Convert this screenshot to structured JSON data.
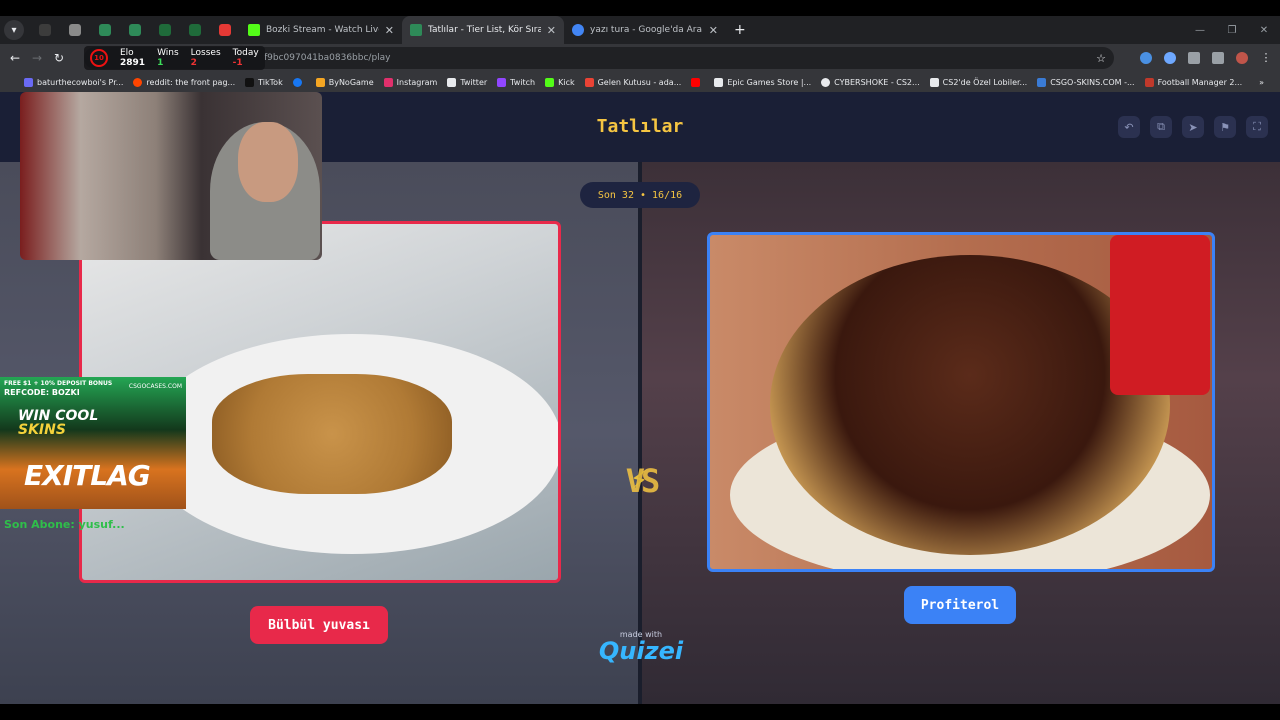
{
  "browser": {
    "tabs": [
      {
        "label": "Bozki Stream - Watch Live on K",
        "color": "#53fc18",
        "active": false
      },
      {
        "label": "Tatlılar - Tier List, Kör Sıralama,",
        "color": "#2e8a58",
        "active": true
      },
      {
        "label": "yazı tura - Google'da Ara",
        "color": "#4285f4",
        "active": false
      }
    ],
    "url": "f9bc097041ba0836bbc/play",
    "bookmarks": [
      {
        "label": "baturthecowboi's Pr...",
        "color": "#6a6af4"
      },
      {
        "label": "reddit: the front pag...",
        "color": "#ff4500"
      },
      {
        "label": "TikTok",
        "color": "#111111"
      },
      {
        "label": "",
        "color": "#1877f2"
      },
      {
        "label": "ByNoGame",
        "color": "#f5a623"
      },
      {
        "label": "Instagram",
        "color": "#e1306c"
      },
      {
        "label": "Twitter",
        "color": "#e8eaed"
      },
      {
        "label": "Twitch",
        "color": "#9146ff"
      },
      {
        "label": "Kick",
        "color": "#53fc18"
      },
      {
        "label": "Gelen Kutusu - ada...",
        "color": "#ea4335"
      },
      {
        "label": "",
        "color": "#ff0000"
      },
      {
        "label": "Epic Games Store |...",
        "color": "#e8eaed"
      },
      {
        "label": "CYBERSHOKE - CS2...",
        "color": "#e8eaed"
      },
      {
        "label": "CS2'de Özel Lobiler...",
        "color": "#e8eaed"
      },
      {
        "label": "CSGO-SKINS.COM -...",
        "color": "#3a7bd5"
      },
      {
        "label": "Football Manager 2...",
        "color": "#c0392b"
      }
    ],
    "elo": {
      "level": "10",
      "elo_label": "Elo",
      "elo_value": "2891",
      "wins_label": "Wins",
      "wins_value": "1",
      "losses_label": "Losses",
      "losses_value": "2",
      "today_label": "Today",
      "today_value": "-1"
    }
  },
  "page": {
    "title": "Tatlılar",
    "round": "Son 32 • 16/16",
    "left_option": "Bülbül yuvası",
    "right_option": "Profiterol",
    "vs": "VS",
    "made_with": "made with",
    "brand": "Quizei"
  },
  "overlays": {
    "ad_line1": "FREE $1 + 10% DEPOSIT BONUS",
    "ad_code": "REFCODE: BOZKI",
    "ad_site": "CSGOCASES.COM",
    "ad_headline_1": "WIN COOL",
    "ad_headline_2": "SKINS",
    "ad_brand": "EXITLAG",
    "subscriber": "Son Abone: yusuf..."
  },
  "colors": {
    "accent_yellow": "#f5c542",
    "left_red": "#e8294a",
    "right_blue": "#3b82f6"
  }
}
